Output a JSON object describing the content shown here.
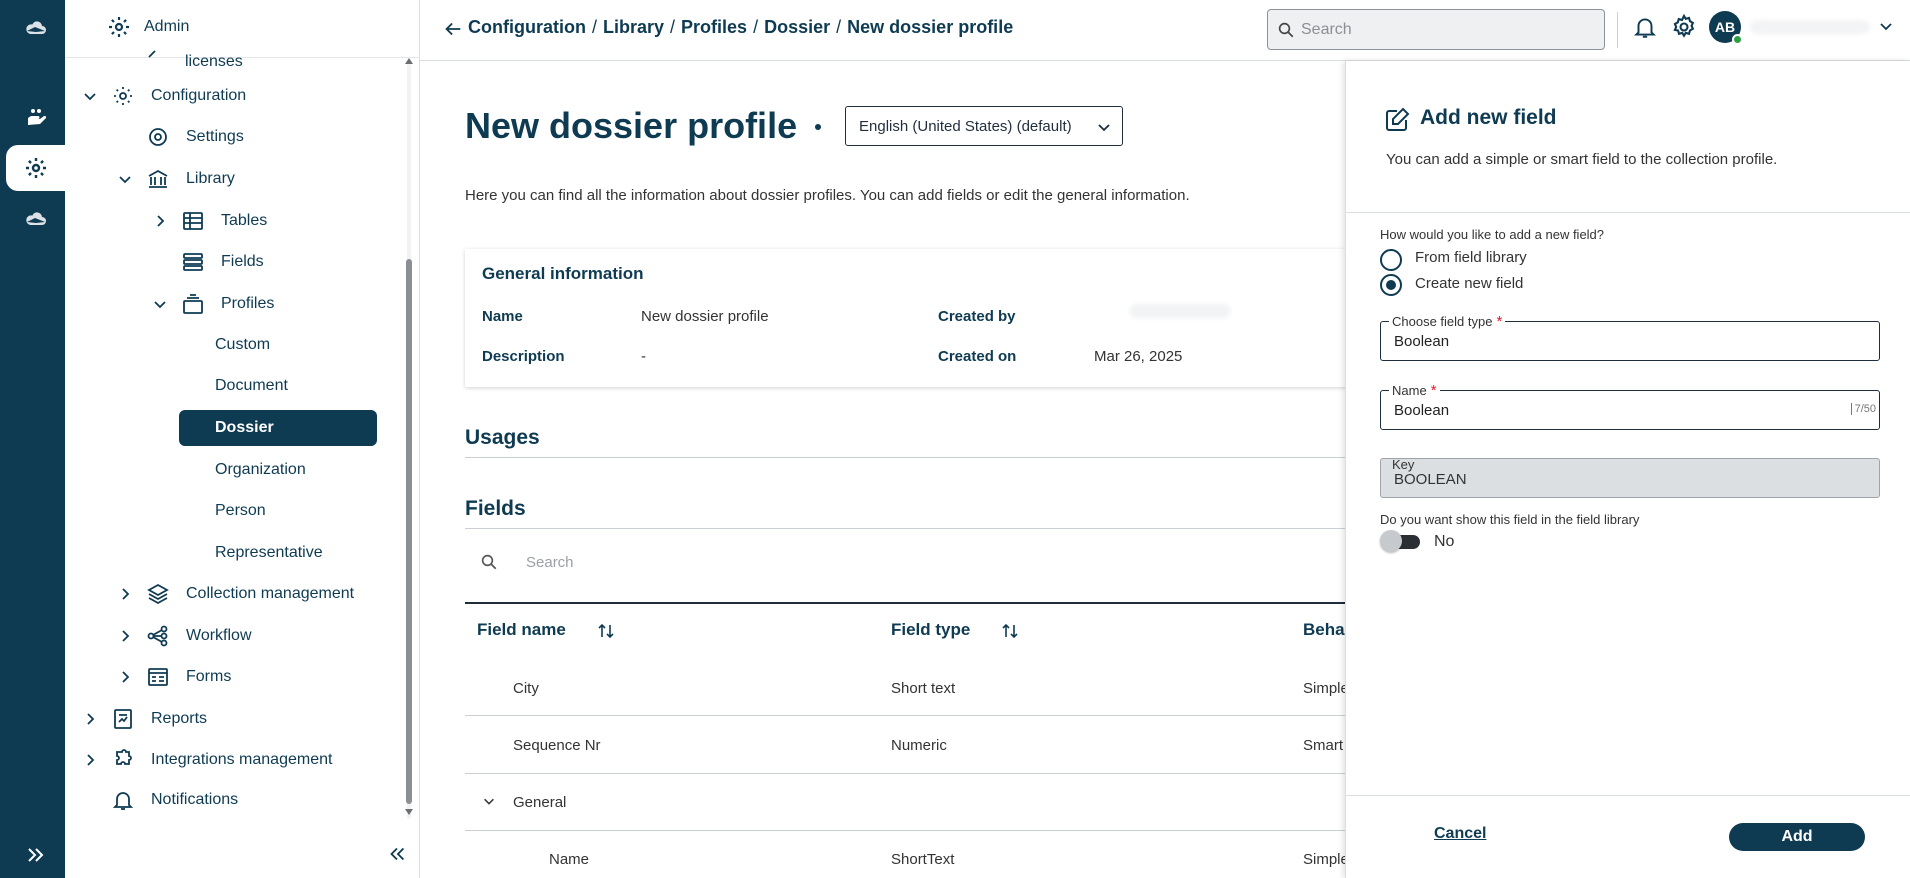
{
  "rail": {
    "icons": [
      "cloud-logo-icon",
      "hand-icon",
      "settings-icon",
      "cloud-icon",
      "expand-icon"
    ]
  },
  "sidebar": {
    "header_title": "Admin",
    "items": [
      {
        "label": "licenses"
      },
      {
        "label": "Configuration"
      },
      {
        "label": "Settings"
      },
      {
        "label": "Library"
      },
      {
        "label": "Tables"
      },
      {
        "label": "Fields"
      },
      {
        "label": "Profiles"
      },
      {
        "label": "Custom"
      },
      {
        "label": "Document"
      },
      {
        "label": "Dossier"
      },
      {
        "label": "Organization"
      },
      {
        "label": "Person"
      },
      {
        "label": "Representative"
      },
      {
        "label": "Collection management"
      },
      {
        "label": "Workflow"
      },
      {
        "label": "Forms"
      },
      {
        "label": "Reports"
      },
      {
        "label": "Integrations management"
      },
      {
        "label": "Notifications"
      }
    ]
  },
  "topbar": {
    "breadcrumb": [
      "Configuration",
      "Library",
      "Profiles",
      "Dossier",
      "New dossier profile"
    ],
    "separator": "/",
    "search_placeholder": "Search",
    "avatar_initials": "AB"
  },
  "main": {
    "title": "New dossier profile",
    "language": "English (United States) (default)",
    "intro": "Here you can find all the information about dossier profiles. You can add fields or edit the general information.",
    "general": {
      "title": "General information",
      "name_label": "Name",
      "name_value": "New dossier profile",
      "description_label": "Description",
      "description_value": "-",
      "created_by_label": "Created by",
      "created_on_label": "Created on",
      "created_on_value": "Mar 26, 2025"
    },
    "usages_title": "Usages",
    "fields_title": "Fields",
    "fields_search_placeholder": "Search",
    "table": {
      "columns": [
        "Field name",
        "Field type",
        "Beha"
      ],
      "rows": [
        {
          "name": "City",
          "type": "Short text",
          "behavior": "Simple"
        },
        {
          "name": "Sequence Nr",
          "type": "Numeric",
          "behavior": "Smart"
        },
        {
          "group": "General"
        },
        {
          "name": "Name",
          "type": "ShortText",
          "behavior": "Simple"
        }
      ]
    }
  },
  "drawer": {
    "title": "Add new field",
    "description": "You can add a simple or smart field to the collection profile.",
    "question": "How would you like to add a new field?",
    "options": [
      "From field library",
      "Create new field"
    ],
    "selected_option": "Create new field",
    "field_type_label": "Choose field type",
    "field_type_value": "Boolean",
    "name_label": "Name",
    "name_value": "Boolean",
    "name_counter": "7/50",
    "key_label": "Key",
    "key_value": "BOOLEAN",
    "show_question": "Do you want show this field in the field library",
    "toggle_label": "No",
    "cancel_label": "Cancel",
    "add_label": "Add",
    "required_mark": "*"
  },
  "colors": {
    "primary": "#0f3b52",
    "required": "#e0192b",
    "online": "#2e9e44"
  }
}
